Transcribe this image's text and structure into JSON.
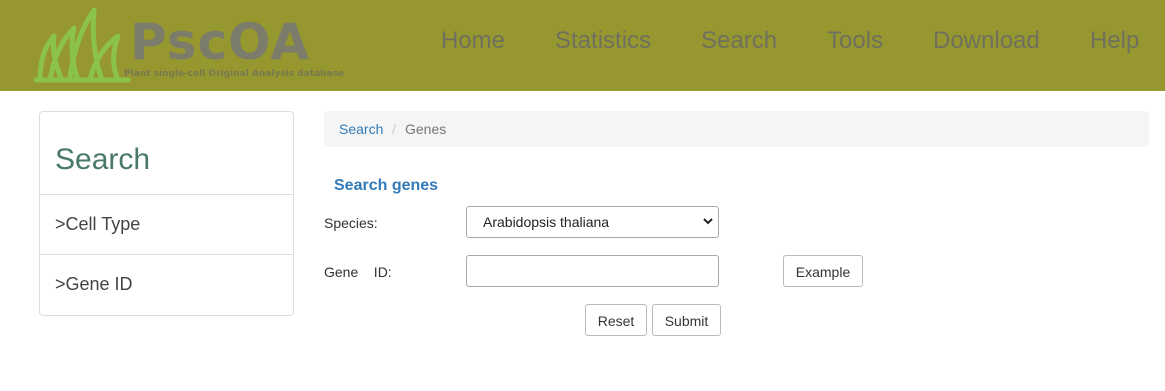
{
  "header": {
    "logo_text": "PscOA",
    "logo_subtitle": "Plant single-cell Original Analysis database",
    "nav": [
      "Home",
      "Statistics",
      "Search",
      "Tools",
      "Download",
      "Help"
    ],
    "colors": {
      "bar": "#96972f",
      "logo_leaf": "#8bc34a"
    }
  },
  "sidebar": {
    "title": "Search",
    "items": [
      ">Cell Type",
      ">Gene ID"
    ]
  },
  "breadcrumb": {
    "parent": "Search",
    "separator": "/",
    "current": "Genes"
  },
  "form": {
    "title": "Search genes",
    "species_label": "Species:",
    "species_value": "Arabidopsis thaliana",
    "gene_label": "Gene    ID:",
    "gene_value": "",
    "example_button": "Example",
    "reset_button": "Reset",
    "submit_button": "Submit"
  }
}
